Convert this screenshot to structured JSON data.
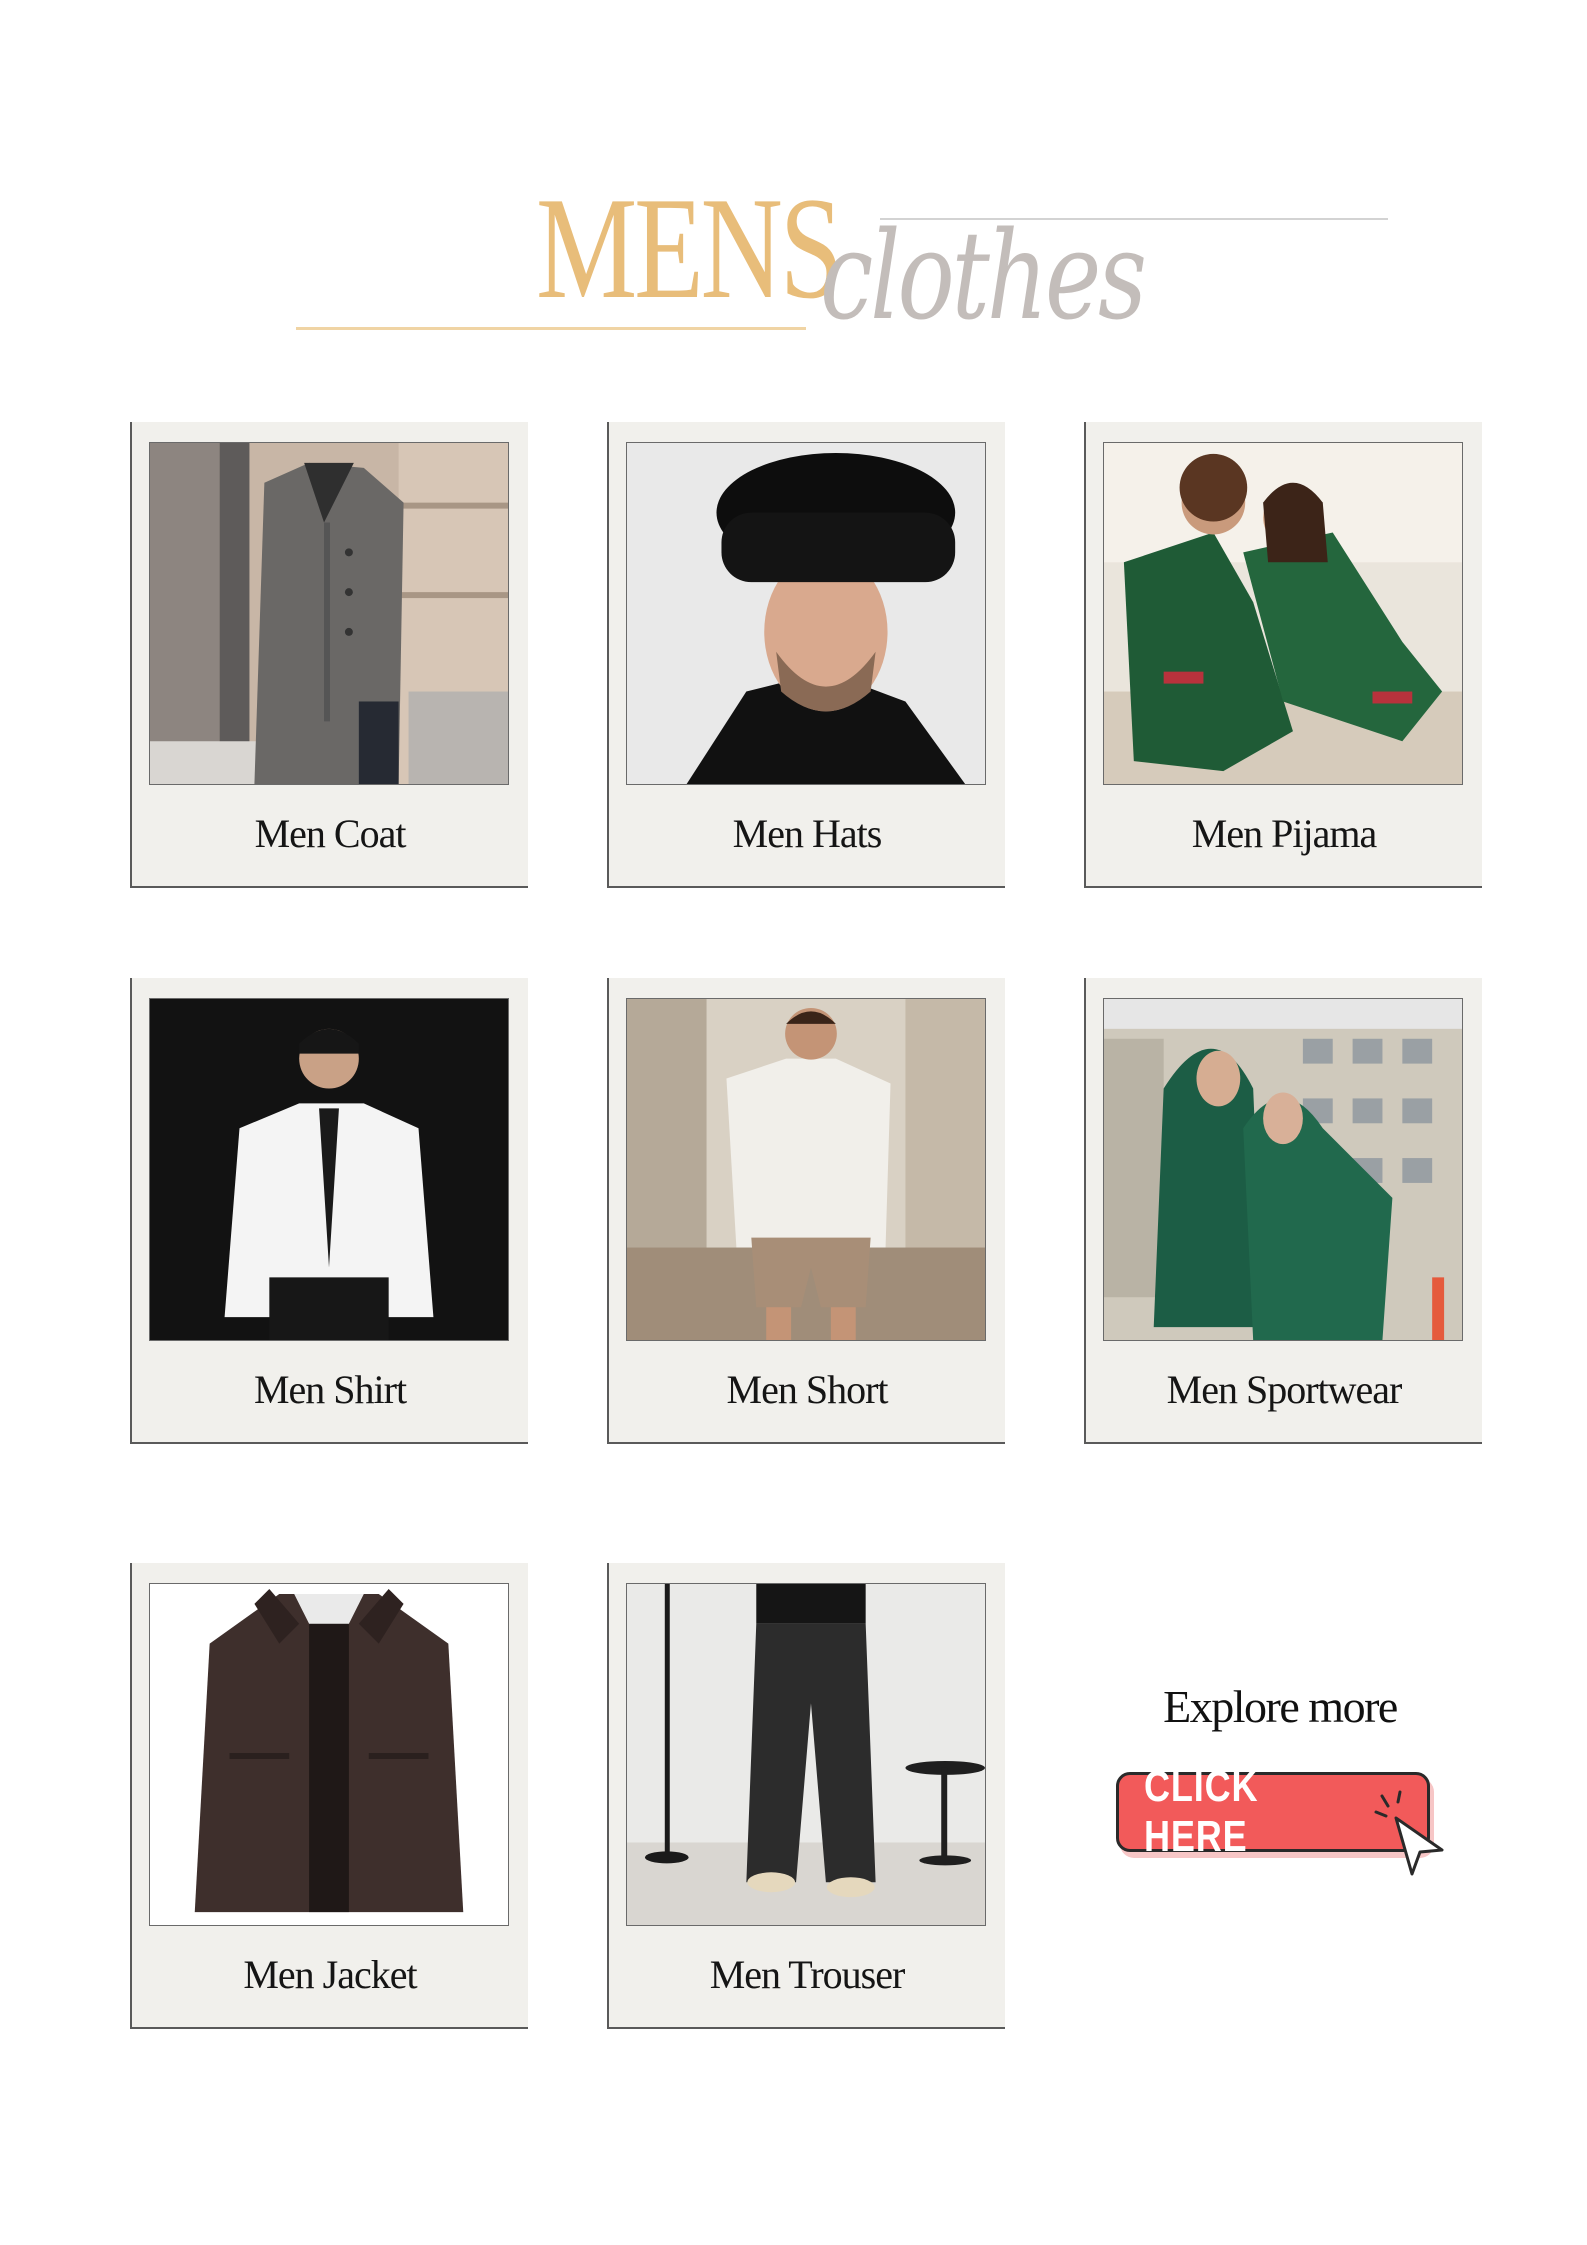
{
  "title": {
    "word1": "MENS",
    "word2": "clothes"
  },
  "categories": [
    {
      "label": "Men Coat",
      "icon": "coat-photo"
    },
    {
      "label": "Men Hats",
      "icon": "fur-hat-photo"
    },
    {
      "label": "Men Pijama",
      "icon": "pajama-photo"
    },
    {
      "label": "Men Shirt",
      "icon": "shirt-photo"
    },
    {
      "label": "Men Short",
      "icon": "shorts-photo"
    },
    {
      "label": "Men Sportwear",
      "icon": "sportwear-photo"
    },
    {
      "label": "Men Jacket",
      "icon": "leather-jacket-photo"
    },
    {
      "label": "Men Trouser",
      "icon": "trouser-photo"
    }
  ],
  "cta": {
    "heading": "Explore more",
    "button_label": "CLICK HERE",
    "icon": "pointer-cursor-icon"
  },
  "colors": {
    "title_gold": "#e8bd7a",
    "title_grey": "#c3bdba",
    "card_bg": "#f1f0ec",
    "button_red": "#f25a5a"
  }
}
